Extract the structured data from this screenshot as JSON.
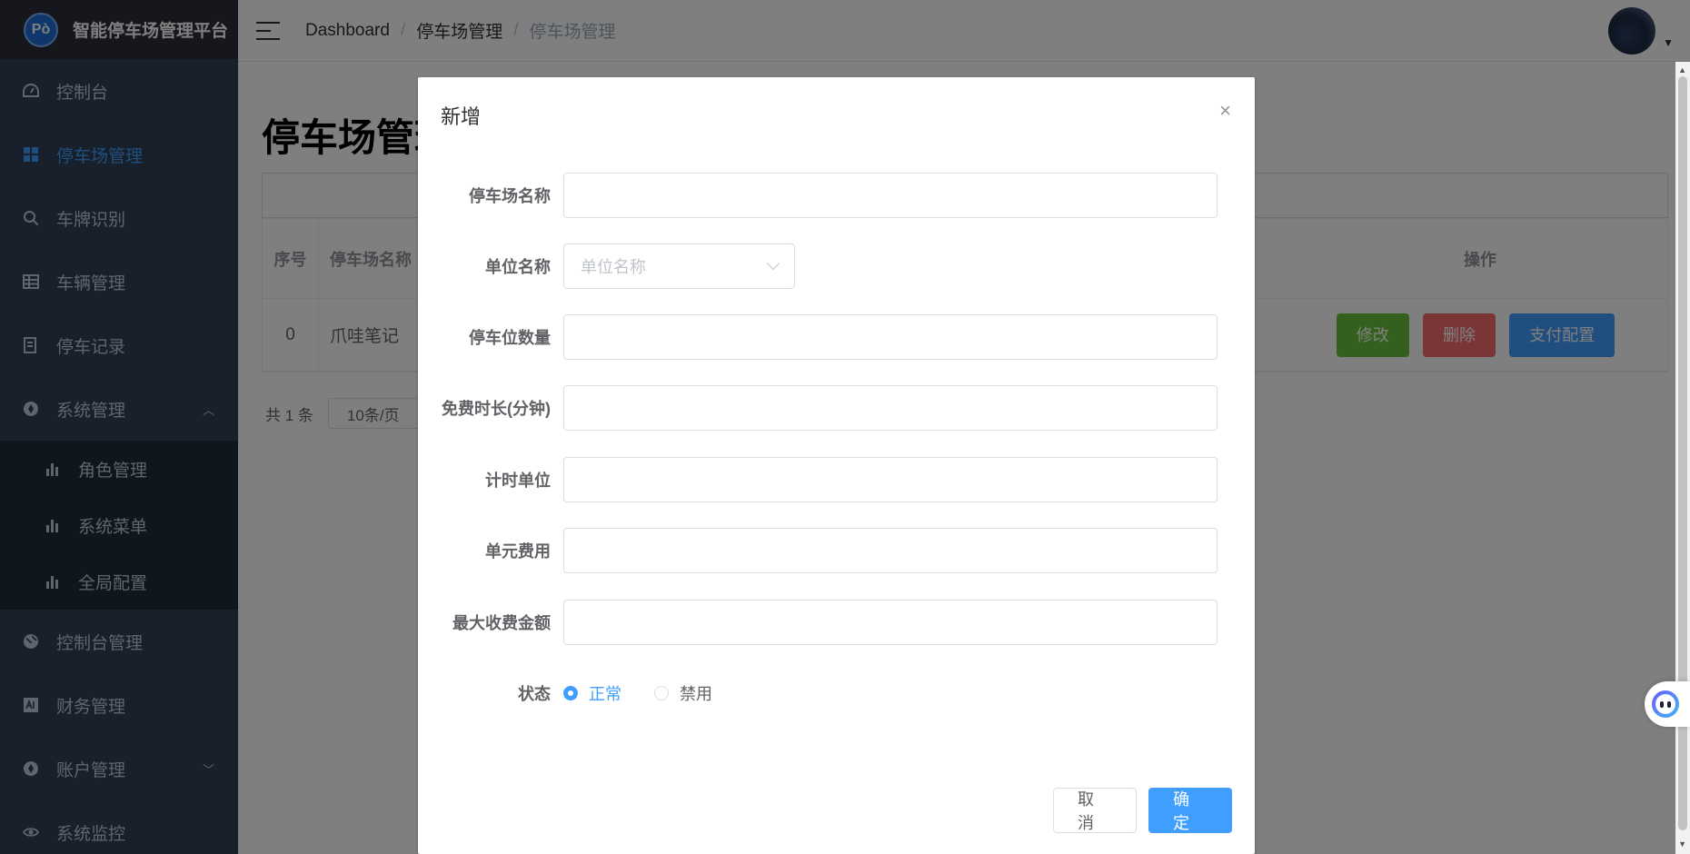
{
  "app": {
    "logo_text": "Pò",
    "title": "智能停车场管理平台"
  },
  "sidebar": {
    "items": [
      {
        "label": "控制台",
        "icon": "dashboard-icon"
      },
      {
        "label": "停车场管理",
        "icon": "grid-icon",
        "active": true
      },
      {
        "label": "车牌识别",
        "icon": "search-icon"
      },
      {
        "label": "车辆管理",
        "icon": "table-icon"
      },
      {
        "label": "停车记录",
        "icon": "record-icon"
      },
      {
        "label": "系统管理",
        "icon": "settings-icon",
        "expanded": true
      }
    ],
    "submenu": [
      {
        "label": "角色管理",
        "icon": "bar-chart-icon"
      },
      {
        "label": "系统菜单",
        "icon": "bar-chart-icon"
      },
      {
        "label": "全局配置",
        "icon": "bar-chart-icon"
      }
    ],
    "items_after": [
      {
        "label": "控制台管理",
        "icon": "globe-icon"
      },
      {
        "label": "财务管理",
        "icon": "finance-icon"
      },
      {
        "label": "账户管理",
        "icon": "account-icon"
      },
      {
        "label": "系统监控",
        "icon": "eye-icon"
      }
    ]
  },
  "header": {
    "breadcrumb": [
      "Dashboard",
      "停车场管理",
      "停车场管理"
    ],
    "separator": "/"
  },
  "page": {
    "title": "停车场管理",
    "table": {
      "headers": {
        "index": "序号",
        "name": "停车场名称",
        "ops": "操作"
      },
      "rows": [
        {
          "index": "0",
          "name": "爪哇笔记"
        }
      ],
      "actions": {
        "edit": "修改",
        "delete": "删除",
        "pay_config": "支付配置"
      }
    },
    "pagination": {
      "total": "共 1 条",
      "page_size": "10条/页"
    }
  },
  "dialog": {
    "title": "新增",
    "close": "×",
    "fields": {
      "lot_name": {
        "label": "停车场名称",
        "value": ""
      },
      "unit_name": {
        "label": "单位名称",
        "placeholder": "单位名称"
      },
      "space_count": {
        "label": "停车位数量",
        "value": ""
      },
      "free_minutes": {
        "label": "免费时长(分钟)",
        "value": ""
      },
      "time_unit": {
        "label": "计时单位",
        "value": ""
      },
      "unit_fee": {
        "label": "单元费用",
        "value": ""
      },
      "max_fee": {
        "label": "最大收费金额",
        "value": ""
      },
      "status": {
        "label": "状态",
        "options": [
          "正常",
          "禁用"
        ],
        "selected": "正常"
      }
    },
    "buttons": {
      "cancel": "取 消",
      "confirm": "确 定"
    }
  },
  "colors": {
    "primary": "#409eff",
    "success": "#67c23a",
    "danger": "#f56c6c",
    "sidebar_bg": "#304156"
  }
}
